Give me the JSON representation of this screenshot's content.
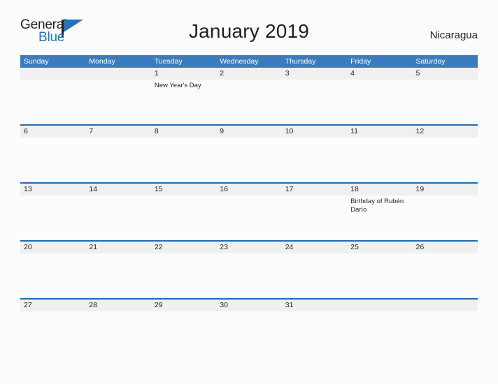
{
  "brand": {
    "name_top": "General",
    "name_bottom": "Blue",
    "flag_icon": "flag-icon",
    "color_text": "#231f20",
    "color_blue": "#2572b8"
  },
  "header": {
    "title": "January 2019",
    "locale": "Nicaragua"
  },
  "theme": {
    "header_blue": "#3a7cbe",
    "row_border_blue": "#1f6cb0",
    "band_gray": "#f0f0f0",
    "page_background": "#fcfcfc"
  },
  "calendar": {
    "weekdays": [
      "Sunday",
      "Monday",
      "Tuesday",
      "Wednesday",
      "Thursday",
      "Friday",
      "Saturday"
    ],
    "weeks": [
      [
        {
          "day": "",
          "events": []
        },
        {
          "day": "",
          "events": []
        },
        {
          "day": "1",
          "events": [
            "New Year's Day"
          ]
        },
        {
          "day": "2",
          "events": []
        },
        {
          "day": "3",
          "events": []
        },
        {
          "day": "4",
          "events": []
        },
        {
          "day": "5",
          "events": []
        }
      ],
      [
        {
          "day": "6",
          "events": []
        },
        {
          "day": "7",
          "events": []
        },
        {
          "day": "8",
          "events": []
        },
        {
          "day": "9",
          "events": []
        },
        {
          "day": "10",
          "events": []
        },
        {
          "day": "11",
          "events": []
        },
        {
          "day": "12",
          "events": []
        }
      ],
      [
        {
          "day": "13",
          "events": []
        },
        {
          "day": "14",
          "events": []
        },
        {
          "day": "15",
          "events": []
        },
        {
          "day": "16",
          "events": []
        },
        {
          "day": "17",
          "events": []
        },
        {
          "day": "18",
          "events": [
            "Birthday of Rubén Darío"
          ]
        },
        {
          "day": "19",
          "events": []
        }
      ],
      [
        {
          "day": "20",
          "events": []
        },
        {
          "day": "21",
          "events": []
        },
        {
          "day": "22",
          "events": []
        },
        {
          "day": "23",
          "events": []
        },
        {
          "day": "24",
          "events": []
        },
        {
          "day": "25",
          "events": []
        },
        {
          "day": "26",
          "events": []
        }
      ],
      [
        {
          "day": "27",
          "events": []
        },
        {
          "day": "28",
          "events": []
        },
        {
          "day": "29",
          "events": []
        },
        {
          "day": "30",
          "events": []
        },
        {
          "day": "31",
          "events": []
        },
        {
          "day": "",
          "events": []
        },
        {
          "day": "",
          "events": []
        }
      ]
    ]
  }
}
